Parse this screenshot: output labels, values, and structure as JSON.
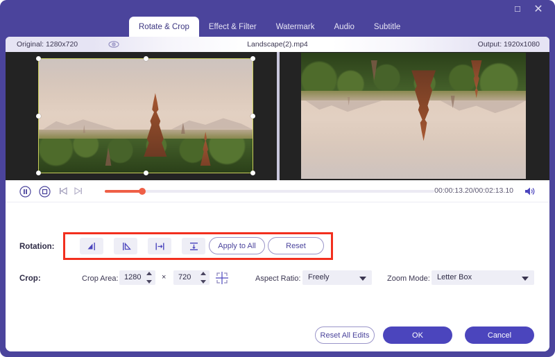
{
  "window": {
    "maximize_icon": "maximize-icon",
    "close_icon": "close-icon"
  },
  "tabs": [
    {
      "label": "Rotate & Crop",
      "active": true
    },
    {
      "label": "Effect & Filter",
      "active": false
    },
    {
      "label": "Watermark",
      "active": false
    },
    {
      "label": "Audio",
      "active": false
    },
    {
      "label": "Subtitle",
      "active": false
    }
  ],
  "info": {
    "original": "Original: 1280x720",
    "eye_icon": "eye-icon",
    "filename": "Landscape(2).mp4",
    "output": "Output: 1920x1080"
  },
  "preview": {
    "left_title": "original-preview",
    "right_title": "output-preview"
  },
  "playback": {
    "pause_icon": "pause-icon",
    "stop_icon": "stop-icon",
    "prev_icon": "previous-frame-icon",
    "next_icon": "next-frame-icon",
    "time": "00:00:13.20/00:02:13.10",
    "volume_icon": "volume-icon",
    "progress_percent": 11
  },
  "rotation": {
    "label": "Rotation:",
    "buttons": [
      {
        "name": "rotate-left-icon"
      },
      {
        "name": "rotate-right-icon"
      },
      {
        "name": "flip-horizontal-icon"
      },
      {
        "name": "flip-vertical-icon"
      }
    ],
    "apply_to_all": "Apply to All",
    "reset": "Reset"
  },
  "crop": {
    "label": "Crop:",
    "area_label": "Crop Area:",
    "width": "1280",
    "times": "×",
    "height": "720",
    "center_icon": "crop-center-icon",
    "aspect_label": "Aspect Ratio:",
    "aspect_value": "Freely",
    "zoom_label": "Zoom Mode:",
    "zoom_value": "Letter Box"
  },
  "footer": {
    "reset_all": "Reset All Edits",
    "ok": "OK",
    "cancel": "Cancel"
  },
  "colors": {
    "brand_purple": "#4b449c",
    "accent_button": "#4b45bd",
    "slider": "#ef5f46",
    "crop_frame": "#c9cf5a",
    "annotation_red": "#f22f1e"
  }
}
